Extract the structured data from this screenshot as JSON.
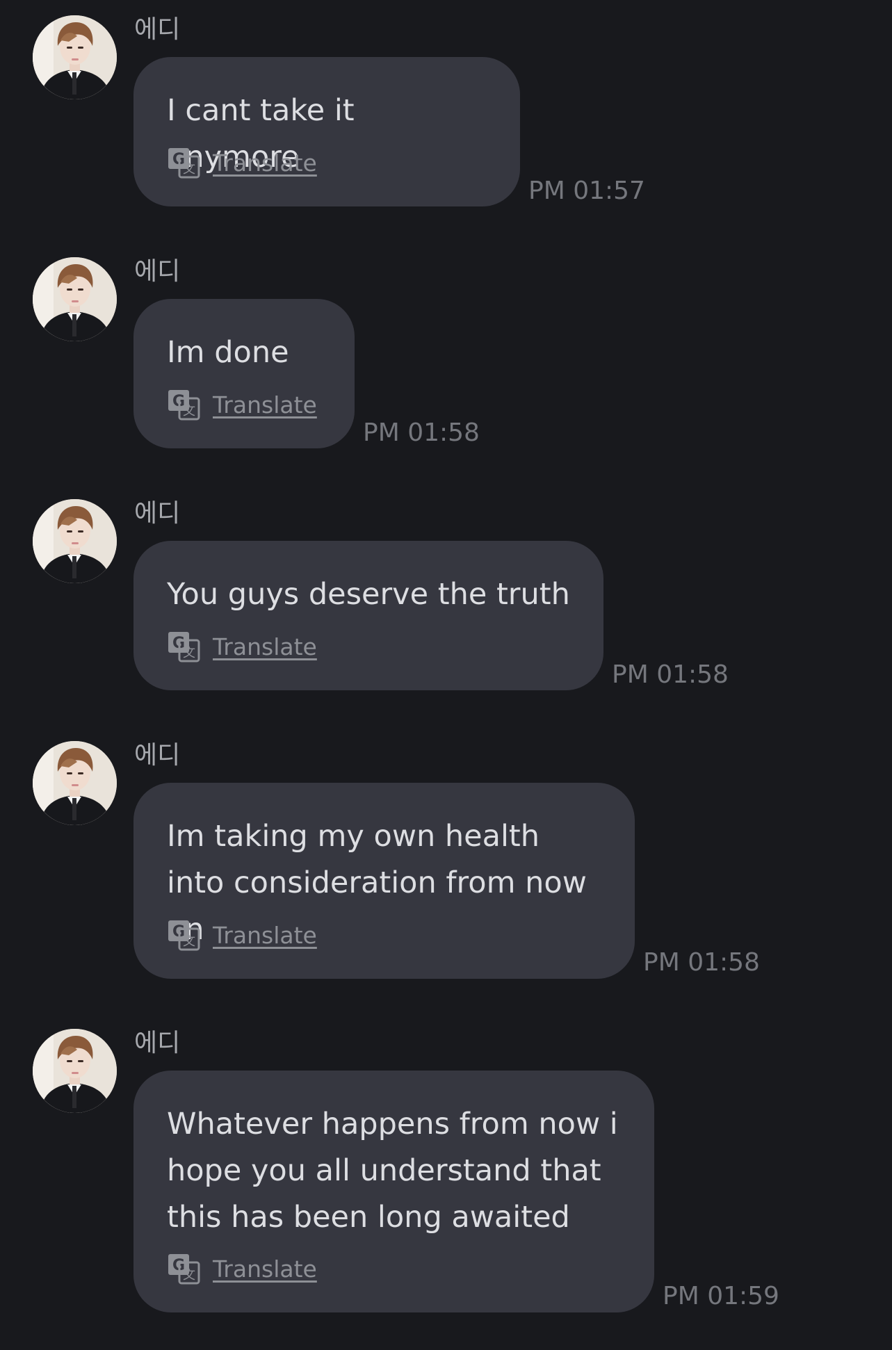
{
  "messages": [
    {
      "sender": "에디",
      "text": "I cant take it anymore",
      "translate_label": "Translate",
      "time": "PM 01:57"
    },
    {
      "sender": "에디",
      "text": "Im done",
      "translate_label": "Translate",
      "time": "PM 01:58"
    },
    {
      "sender": "에디",
      "text": "You guys deserve the truth",
      "translate_label": "Translate",
      "time": "PM 01:58"
    },
    {
      "sender": "에디",
      "text": "Im taking my own health into consideration from now on",
      "translate_label": "Translate",
      "time": "PM 01:58"
    },
    {
      "sender": "에디",
      "text": "Whatever happens from now i hope you all understand that this has been long awaited",
      "translate_label": "Translate",
      "time": "PM 01:59"
    }
  ],
  "icons": {
    "avatar": "profile-photo",
    "translate": "translate-icon"
  },
  "colors": {
    "background": "#18191d",
    "bubble": "#363740",
    "text": "#dddee2",
    "muted": "#8e9096"
  }
}
